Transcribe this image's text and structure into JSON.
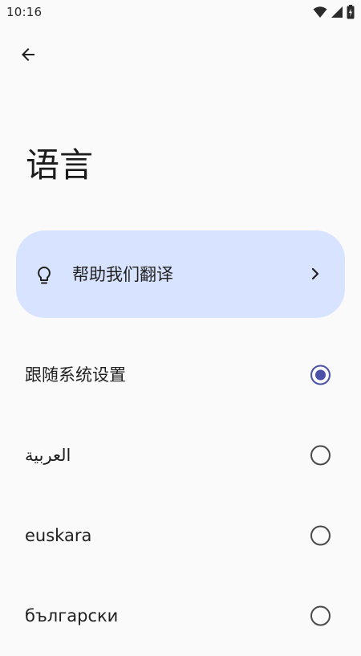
{
  "status_bar": {
    "time": "10:16",
    "icons": [
      "wifi-icon",
      "cell-signal-icon",
      "battery-charging-icon"
    ]
  },
  "nav": {
    "back_icon": "arrow-back-icon"
  },
  "page": {
    "title": "语言"
  },
  "help_card": {
    "label": "帮助我们翻译",
    "icon": "lightbulb-icon",
    "trailing_icon": "chevron-right-icon",
    "background": "#d8e3ff"
  },
  "languages": [
    {
      "label": "跟随系统设置",
      "selected": true
    },
    {
      "label": "العربية",
      "selected": false
    },
    {
      "label": "euskara",
      "selected": false
    },
    {
      "label": "български",
      "selected": false
    }
  ],
  "colors": {
    "accent": "#4a52a8",
    "background": "#fafafa"
  }
}
